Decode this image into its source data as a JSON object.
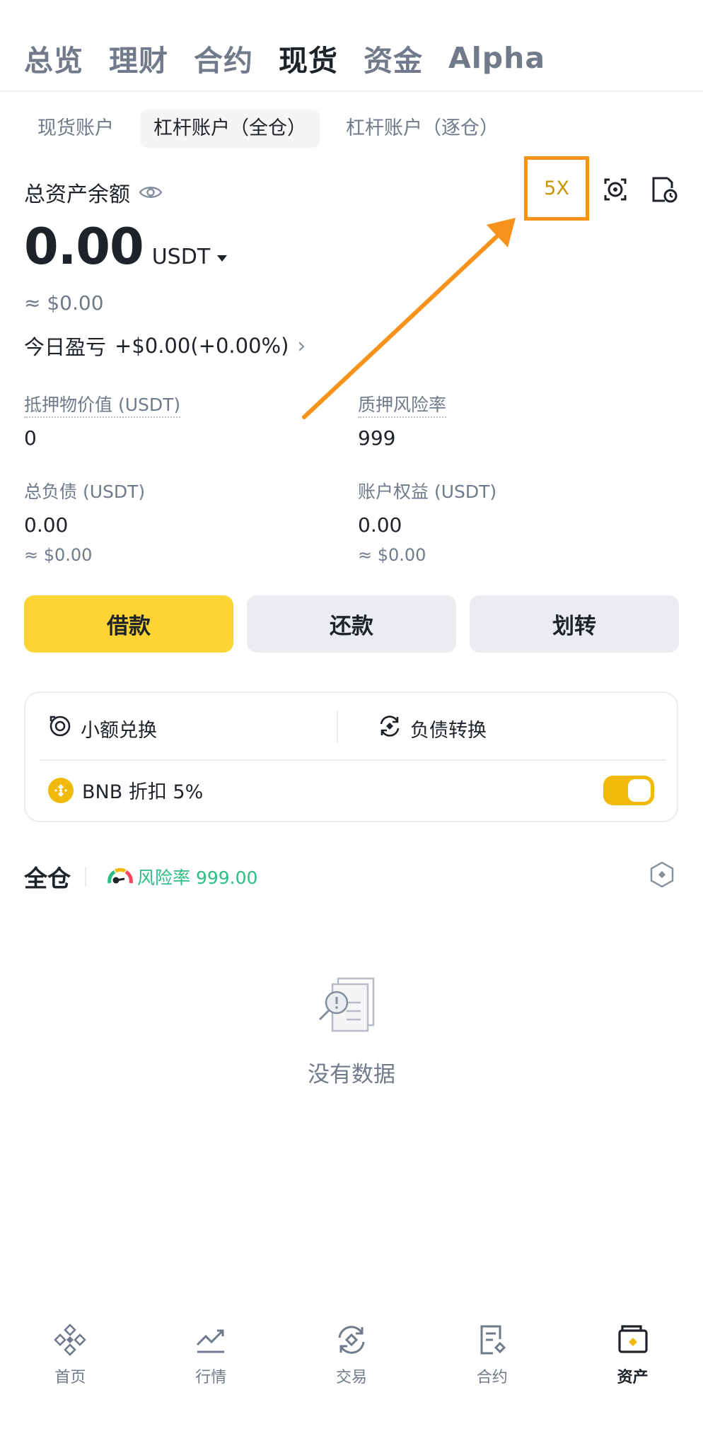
{
  "top_tabs": [
    {
      "label": "总览"
    },
    {
      "label": "理财"
    },
    {
      "label": "合约"
    },
    {
      "label": "现货"
    },
    {
      "label": "资金"
    },
    {
      "label": "Alpha"
    }
  ],
  "sub_tabs": [
    {
      "label": "现货账户"
    },
    {
      "label": "杠杆账户（全仓）"
    },
    {
      "label": "杠杆账户（逐仓）"
    }
  ],
  "balance": {
    "label": "总资产余额",
    "leverage": "5X",
    "amount": "0.00",
    "unit": "USDT",
    "approx": "≈ $0.00",
    "pnl_label": "今日盈亏",
    "pnl_value": "+$0.00(+0.00%)"
  },
  "metrics": {
    "collateral": {
      "label": "抵押物价值 (USDT)",
      "value": "0"
    },
    "risk_ratio": {
      "label": "质押风险率",
      "value": "999"
    },
    "total_debt": {
      "label": "总负债 (USDT)",
      "value": "0.00",
      "approx": "≈ $0.00"
    },
    "equity": {
      "label": "账户权益 (USDT)",
      "value": "0.00",
      "approx": "≈ $0.00"
    }
  },
  "actions": {
    "borrow": "借款",
    "repay": "还款",
    "transfer": "划转"
  },
  "tools": {
    "small_convert": "小额兑换",
    "debt_convert": "负债转换",
    "bnb_discount": "BNB 折扣 5%",
    "bnb_toggle_on": true
  },
  "cross": {
    "title": "全仓",
    "risk_label": "风险率 999.00"
  },
  "empty": {
    "text": "没有数据"
  },
  "bottom_nav": [
    {
      "label": "首页",
      "icon": "home-icon"
    },
    {
      "label": "行情",
      "icon": "markets-icon"
    },
    {
      "label": "交易",
      "icon": "trade-icon"
    },
    {
      "label": "合约",
      "icon": "futures-icon"
    },
    {
      "label": "资产",
      "icon": "wallet-icon"
    }
  ],
  "colors": {
    "brand_yellow": "#fcd535",
    "annotation_orange": "#f7931a",
    "positive_green": "#2ebd85",
    "text_primary": "#1e2329",
    "text_secondary": "#707a8a"
  }
}
